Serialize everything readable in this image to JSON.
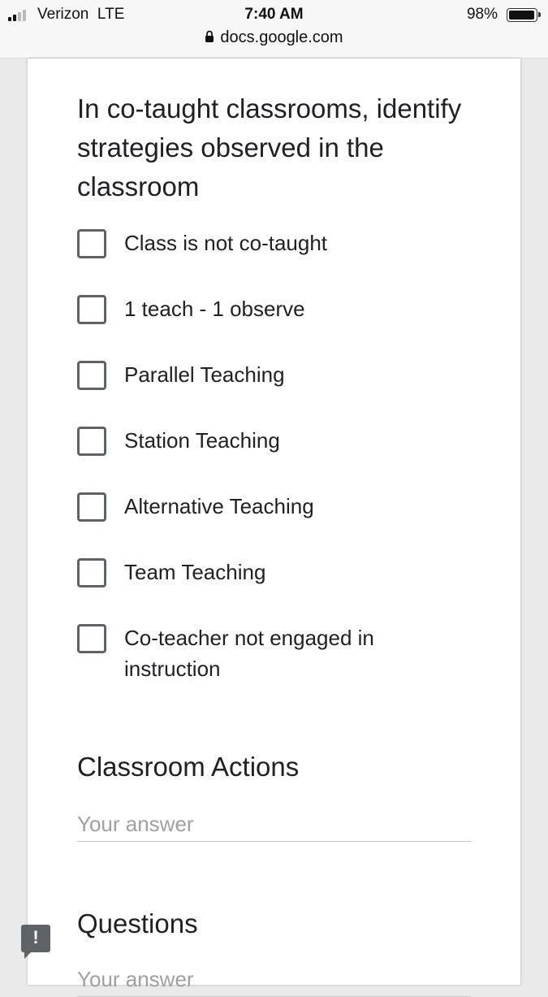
{
  "status_bar": {
    "carrier": "Verizon  LTE",
    "time": "7:40 AM",
    "battery_percent": "98%",
    "battery_level": 0.98,
    "url": "docs.google.com"
  },
  "form": {
    "question": {
      "title": "In co-taught classrooms, identify strategies observed in the classroom",
      "options": [
        {
          "label": "Class is not co-taught",
          "checked": false
        },
        {
          "label": "1 teach - 1 observe",
          "checked": false
        },
        {
          "label": "Parallel Teaching",
          "checked": false
        },
        {
          "label": "Station Teaching",
          "checked": false
        },
        {
          "label": "Alternative Teaching",
          "checked": false
        },
        {
          "label": "Team Teaching",
          "checked": false
        },
        {
          "label": "Co-teacher not engaged in instruction",
          "checked": false
        }
      ]
    },
    "classroom_actions": {
      "title": "Classroom Actions",
      "value": "",
      "placeholder": "Your answer"
    },
    "questions": {
      "title": "Questions",
      "value": "",
      "placeholder": "Your answer"
    }
  },
  "feedback": {
    "icon": "exclamation-feedback-icon",
    "glyph": "!"
  },
  "colors": {
    "checkbox_border": "#5f6368",
    "text": "#202124",
    "placeholder": "#a0a0a0",
    "page_background": "#eaeaea"
  }
}
